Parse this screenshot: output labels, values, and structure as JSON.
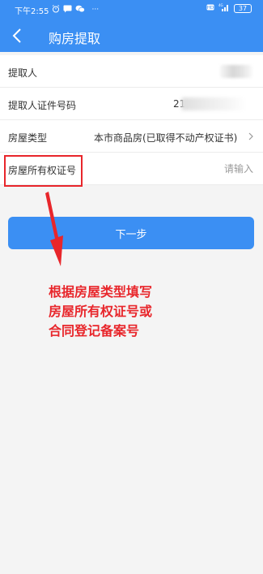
{
  "status_bar": {
    "time": "下午2:55",
    "left_icons": [
      "alarm-icon",
      "message-icon",
      "wechat-icon",
      "more-dots-icon"
    ],
    "dots": "···",
    "right_icons": [
      "hd-icon",
      "signal-4g-icon"
    ],
    "battery": "37"
  },
  "header": {
    "title": "购房提取",
    "back_icon": "chevron-left-icon",
    "bg_color": "#3b8ff3"
  },
  "form": {
    "rows": [
      {
        "label": "提取人",
        "value": ""
      },
      {
        "label": "提取人证件号码",
        "value": "21"
      },
      {
        "label": "房屋类型",
        "value": "本市商品房(已取得不动产权证书)",
        "icon": "chevron-right-icon"
      },
      {
        "label": "房屋所有权证号",
        "placeholder": "请输入"
      }
    ]
  },
  "next_button": {
    "label": "下一步"
  },
  "annotation": {
    "lines": [
      "根据房屋类型填写",
      "房屋所有权证号或",
      "合同登记备案号"
    ],
    "color": "#e8262b"
  }
}
